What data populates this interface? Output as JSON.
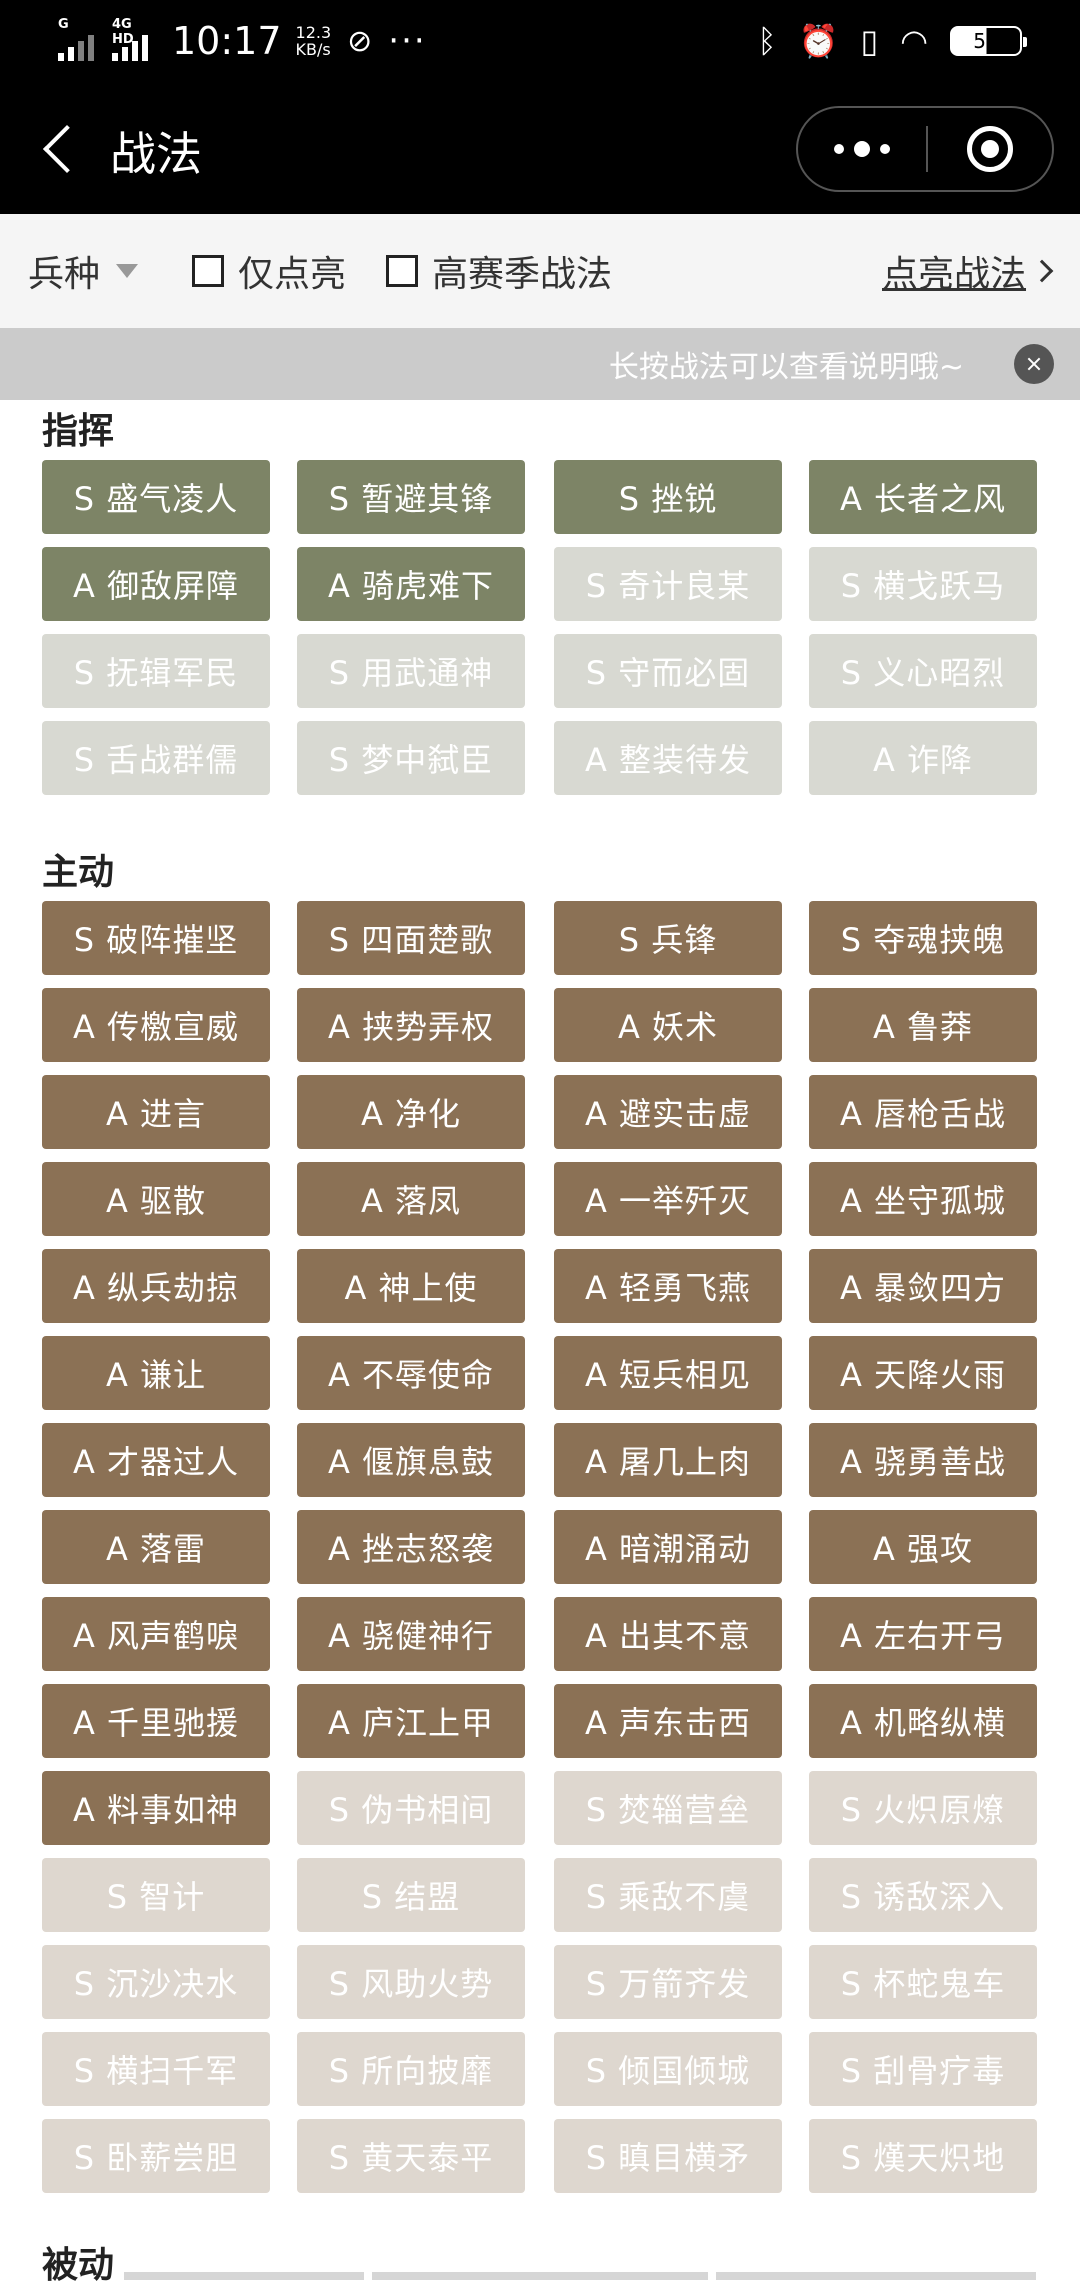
{
  "status_bar": {
    "network_tag_1": "G",
    "network_tag_2": "4G HD",
    "time": "10:17",
    "speed_value": "12.3",
    "speed_unit": "KB/s",
    "dots": "···",
    "battery": "51"
  },
  "header": {
    "title": "战法"
  },
  "filter": {
    "troop_label": "兵种",
    "only_lit_label": "仅点亮",
    "high_season_label": "高赛季战法",
    "light_link": "点亮战法"
  },
  "notice": {
    "text": "长按战法可以查看说明哦~"
  },
  "sections": {
    "command": {
      "title": "指挥",
      "items": [
        {
          "label": "S 盛气凌人",
          "active": true
        },
        {
          "label": "S 暂避其锋",
          "active": true
        },
        {
          "label": "S 挫锐",
          "active": true
        },
        {
          "label": "A 长者之风",
          "active": true
        },
        {
          "label": "A 御敌屏障",
          "active": true
        },
        {
          "label": "A 骑虎难下",
          "active": true
        },
        {
          "label": "S 奇计良某",
          "active": false
        },
        {
          "label": "S 横戈跃马",
          "active": false
        },
        {
          "label": "S 抚辑军民",
          "active": false
        },
        {
          "label": "S 用武通神",
          "active": false
        },
        {
          "label": "S 守而必固",
          "active": false
        },
        {
          "label": "S 义心昭烈",
          "active": false
        },
        {
          "label": "S 舌战群儒",
          "active": false
        },
        {
          "label": "S 梦中弑臣",
          "active": false
        },
        {
          "label": "A 整装待发",
          "active": false
        },
        {
          "label": "A 诈降",
          "active": false
        }
      ]
    },
    "active": {
      "title": "主动",
      "items": [
        {
          "label": "S 破阵摧坚",
          "active": true
        },
        {
          "label": "S 四面楚歌",
          "active": true
        },
        {
          "label": "S 兵锋",
          "active": true
        },
        {
          "label": "S 夺魂挟魄",
          "active": true
        },
        {
          "label": "A 传檄宣威",
          "active": true
        },
        {
          "label": "A 挟势弄权",
          "active": true
        },
        {
          "label": "A 妖术",
          "active": true
        },
        {
          "label": "A 鲁莽",
          "active": true
        },
        {
          "label": "A 进言",
          "active": true
        },
        {
          "label": "A 净化",
          "active": true
        },
        {
          "label": "A 避实击虚",
          "active": true
        },
        {
          "label": "A 唇枪舌战",
          "active": true
        },
        {
          "label": "A 驱散",
          "active": true
        },
        {
          "label": "A 落凤",
          "active": true
        },
        {
          "label": "A 一举歼灭",
          "active": true
        },
        {
          "label": "A 坐守孤城",
          "active": true
        },
        {
          "label": "A 纵兵劫掠",
          "active": true
        },
        {
          "label": "A 神上使",
          "active": true
        },
        {
          "label": "A 轻勇飞燕",
          "active": true
        },
        {
          "label": "A 暴敛四方",
          "active": true
        },
        {
          "label": "A 谦让",
          "active": true
        },
        {
          "label": "A 不辱使命",
          "active": true
        },
        {
          "label": "A 短兵相见",
          "active": true
        },
        {
          "label": "A 天降火雨",
          "active": true
        },
        {
          "label": "A 才器过人",
          "active": true
        },
        {
          "label": "A 偃旗息鼓",
          "active": true
        },
        {
          "label": "A 屠几上肉",
          "active": true
        },
        {
          "label": "A 骁勇善战",
          "active": true
        },
        {
          "label": "A 落雷",
          "active": true
        },
        {
          "label": "A 挫志怒袭",
          "active": true
        },
        {
          "label": "A 暗潮涌动",
          "active": true
        },
        {
          "label": "A 强攻",
          "active": true
        },
        {
          "label": "A 风声鹤唳",
          "active": true
        },
        {
          "label": "A 骁健神行",
          "active": true
        },
        {
          "label": "A 出其不意",
          "active": true
        },
        {
          "label": "A 左右开弓",
          "active": true
        },
        {
          "label": "A 千里驰援",
          "active": true
        },
        {
          "label": "A 庐江上甲",
          "active": true
        },
        {
          "label": "A 声东击西",
          "active": true
        },
        {
          "label": "A 机略纵横",
          "active": true
        },
        {
          "label": "A 料事如神",
          "active": true
        },
        {
          "label": "S 伪书相间",
          "active": false
        },
        {
          "label": "S 焚辎营垒",
          "active": false
        },
        {
          "label": "S 火炽原燎",
          "active": false
        },
        {
          "label": "S 智计",
          "active": false
        },
        {
          "label": "S 结盟",
          "active": false
        },
        {
          "label": "S 乘敌不虞",
          "active": false
        },
        {
          "label": "S 诱敌深入",
          "active": false
        },
        {
          "label": "S 沉沙决水",
          "active": false
        },
        {
          "label": "S 风助火势",
          "active": false
        },
        {
          "label": "S 万箭齐发",
          "active": false
        },
        {
          "label": "S 杯蛇鬼车",
          "active": false
        },
        {
          "label": "S 横扫千军",
          "active": false
        },
        {
          "label": "S 所向披靡",
          "active": false
        },
        {
          "label": "S 倾国倾城",
          "active": false
        },
        {
          "label": "S 刮骨疗毒",
          "active": false
        },
        {
          "label": "S 卧薪尝胆",
          "active": false
        },
        {
          "label": "S 黄天泰平",
          "active": false
        },
        {
          "label": "S 瞋目横矛",
          "active": false
        },
        {
          "label": "S 熯天炽地",
          "active": false
        }
      ]
    },
    "passive": {
      "title": "被动"
    }
  },
  "colors": {
    "command_active": "#7d8466",
    "command_inactive": "#d8d9d2",
    "active_active": "#8b7155",
    "active_inactive": "#ded7cf"
  }
}
